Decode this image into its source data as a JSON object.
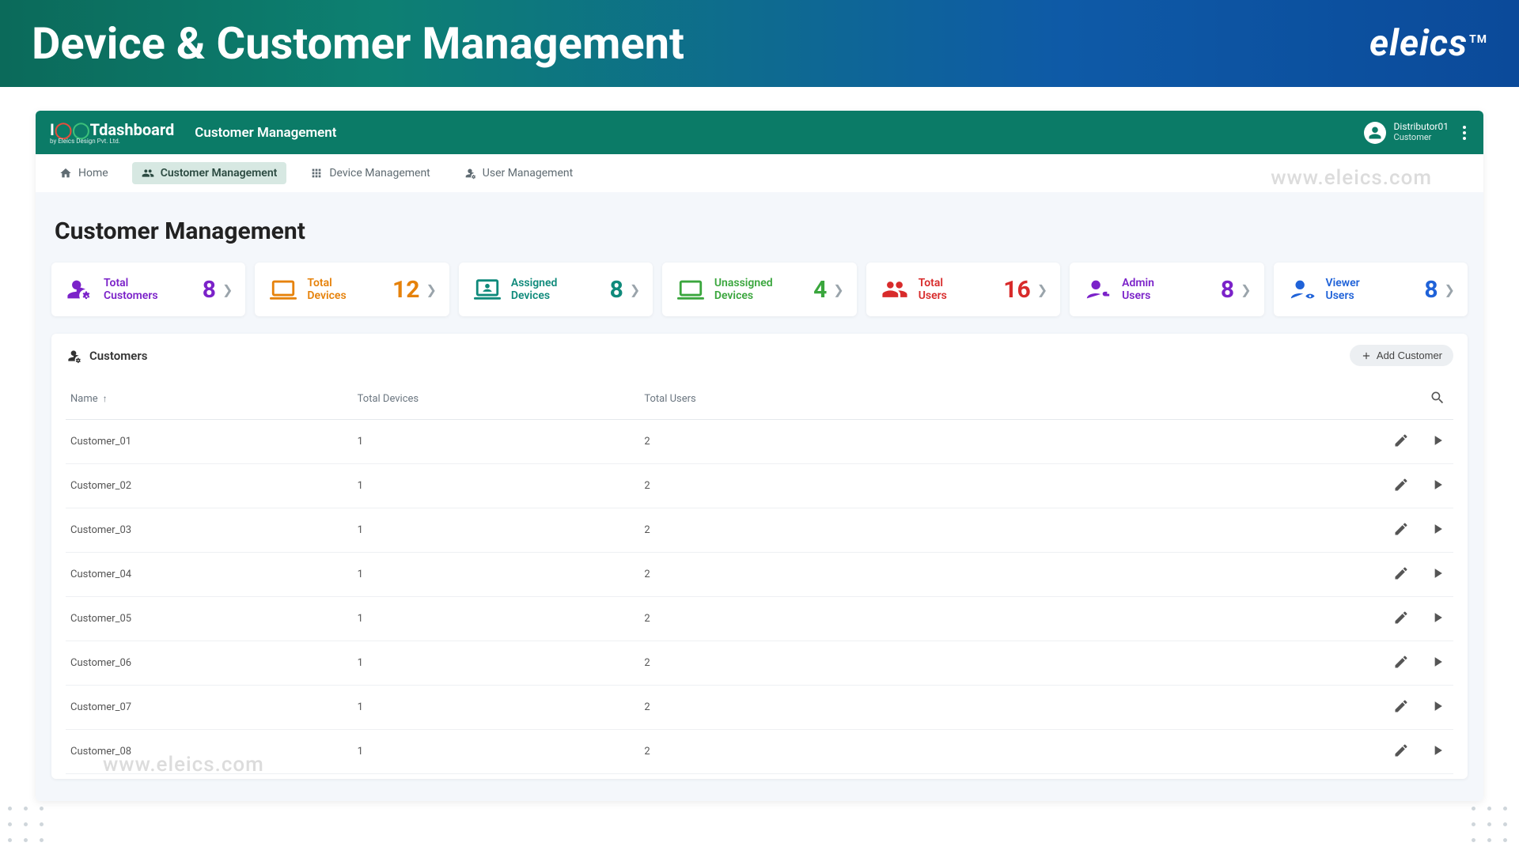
{
  "banner": {
    "title": "Device & Customer Management",
    "brand": "eleics",
    "brand_tm": "TM"
  },
  "app": {
    "logo_prefix": "I",
    "logo_mid": "T",
    "logo_word": "dashboard",
    "logo_sub": "by Eleics Design Pvt. Ltd.",
    "section": "Customer Management",
    "user_name": "Distributor01",
    "user_role": "Customer"
  },
  "nav": {
    "home": "Home",
    "customer": "Customer Management",
    "device": "Device Management",
    "user": "User Management"
  },
  "page": {
    "title": "Customer Management",
    "watermark": "www.eleics.com"
  },
  "stats": {
    "total_customers": {
      "label_a": "Total",
      "label_b": "Customers",
      "value": "8"
    },
    "total_devices": {
      "label_a": "Total",
      "label_b": "Devices",
      "value": "12"
    },
    "assigned": {
      "label_a": "Assigned",
      "label_b": "Devices",
      "value": "8"
    },
    "unassigned": {
      "label": "Unassigned Devices",
      "value": "4"
    },
    "total_users": {
      "label_a": "Total",
      "label_b": "Users",
      "value": "16"
    },
    "admin_users": {
      "label_a": "Admin",
      "label_b": "Users",
      "value": "8"
    },
    "viewer_users": {
      "label_a": "Viewer",
      "label_b": "Users",
      "value": "8"
    }
  },
  "table": {
    "title": "Customers",
    "add_label": "Add Customer",
    "col_name": "Name",
    "col_devices": "Total Devices",
    "col_users": "Total Users",
    "rows": [
      {
        "name": "Customer_01",
        "devices": "1",
        "users": "2"
      },
      {
        "name": "Customer_02",
        "devices": "1",
        "users": "2"
      },
      {
        "name": "Customer_03",
        "devices": "1",
        "users": "2"
      },
      {
        "name": "Customer_04",
        "devices": "1",
        "users": "2"
      },
      {
        "name": "Customer_05",
        "devices": "1",
        "users": "2"
      },
      {
        "name": "Customer_06",
        "devices": "1",
        "users": "2"
      },
      {
        "name": "Customer_07",
        "devices": "1",
        "users": "2"
      },
      {
        "name": "Customer_08",
        "devices": "1",
        "users": "2"
      }
    ]
  }
}
